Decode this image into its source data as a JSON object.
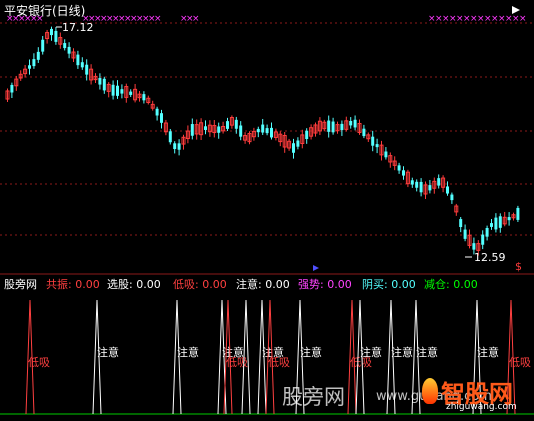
{
  "window": {
    "title": "平安银行(日线)"
  },
  "main_chart": {
    "high_label": "17.12",
    "low_label": "12.59",
    "alert_marker": "$",
    "colors": {
      "up": "#ff3c3c",
      "down": "#54ffff",
      "grid": "#8b1a1a",
      "cross": "#ff39ff"
    }
  },
  "indicator": {
    "items": [
      {
        "label": "股旁网",
        "value": "",
        "color": "#ffffff"
      },
      {
        "label": "共振:",
        "value": "0.00",
        "color": "#ff4040"
      },
      {
        "label": "选股:",
        "value": "0.00",
        "color": "#ffffff"
      },
      {
        "label": "低吸:",
        "value": "0.00",
        "color": "#ff4040"
      },
      {
        "label": "注意:",
        "value": "0.00",
        "color": "#ffffff"
      },
      {
        "label": "强势:",
        "value": "0.00",
        "color": "#ff44ff"
      },
      {
        "label": "阴买:",
        "value": "0.00",
        "color": "#54ffff"
      },
      {
        "label": "减仓:",
        "value": "0.00",
        "color": "#00ff00"
      }
    ],
    "signal_labels": {
      "attention": "注意",
      "low_buy": "低吸"
    }
  },
  "watermark": {
    "left_text": "股旁网",
    "url": "www.gupang.com",
    "brand_cn": "智股网",
    "brand_url": "zhiguwang.com"
  }
}
